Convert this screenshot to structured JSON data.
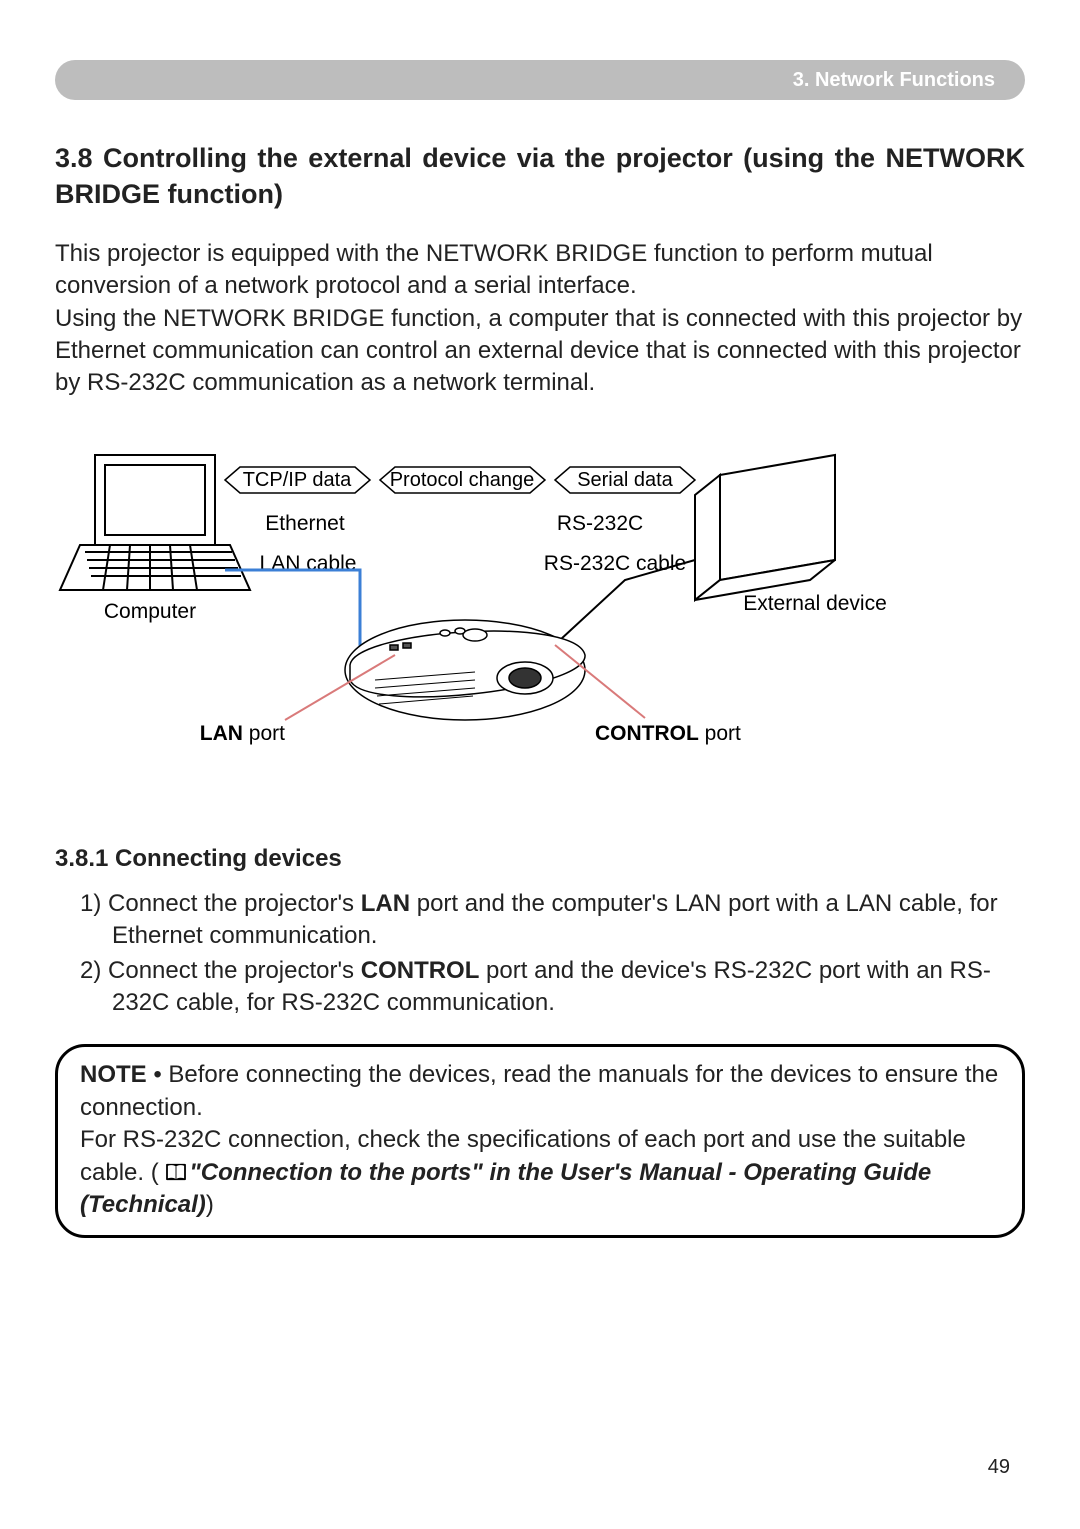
{
  "header": {
    "chapter": "3. Network Functions"
  },
  "section": {
    "title": "3.8 Controlling the external device via the projector (using the NETWORK BRIDGE function)",
    "intro": "This projector is equipped with the NETWORK BRIDGE function to perform mutual conversion of a network protocol and a serial interface.\nUsing the NETWORK BRIDGE function, a computer that is connected with this projector by Ethernet communication can control an external device that is connected with this projector by RS-232C communication as a network terminal."
  },
  "diagram": {
    "labels": {
      "tcp": "TCP/IP data",
      "protocol": "Protocol change",
      "serial": "Serial data",
      "ethernet": "Ethernet",
      "rs232c": "RS-232C",
      "lan_cable": "LAN cable",
      "rs232c_cable": "RS-232C cable",
      "computer": "Computer",
      "external_device": "External device",
      "lan_port_b": "LAN",
      "lan_port_a": " port",
      "control_port_b": "CONTROL",
      "control_port_a": " port"
    }
  },
  "sub": {
    "title": "3.8.1 Connecting devices",
    "steps": {
      "s1_pre": "1) Connect the projector's ",
      "s1_b1": "LAN",
      "s1_post": " port and the computer's LAN port with a LAN cable, for Ethernet communication.",
      "s2_pre": "2) Connect the projector's ",
      "s2_b1": "CONTROL",
      "s2_post": " port and the device's RS-232C port with an RS-232C cable, for RS-232C communication."
    }
  },
  "note": {
    "label": "NOTE",
    "line1": " • Before connecting the devices, read the manuals for the devices to ensure the connection.",
    "line2": "For RS-232C connection, check the specifications of each port and use the suitable cable. (",
    "ref": "\"Connection to the ports\" in the User's Manual - Operating Guide (Technical)",
    "line3": ")"
  },
  "page_num": "49"
}
